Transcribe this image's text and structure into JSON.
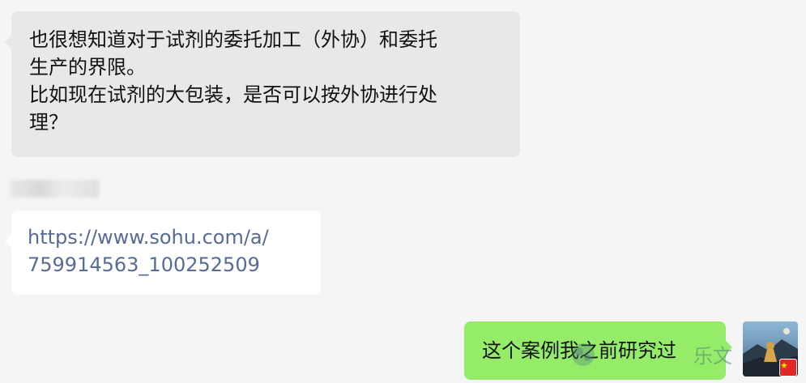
{
  "chat": {
    "messages": [
      {
        "direction": "incoming",
        "lines": [
          "也很想知道对于试剂的委托加工（外协）和委托",
          "生产的界限。",
          "比如现在试剂的大包装，是否可以按外协进行处",
          "理？"
        ]
      },
      {
        "direction": "incoming",
        "lines": [
          "https://www.sohu.com/a/",
          "759914563_100252509"
        ]
      },
      {
        "direction": "outgoing",
        "text": "这个案例我之前研究过"
      }
    ]
  },
  "watermark": {
    "text": "乐文"
  },
  "avatar": {
    "icon": "user-avatar-landscape",
    "badge_icon": "china-flag-icon"
  },
  "colors": {
    "background": "#f5f5f5",
    "incoming_bubble": "#e8e8e8",
    "link_bubble": "#ffffff",
    "outgoing_bubble": "#95ec69",
    "link_text": "#576b95"
  }
}
